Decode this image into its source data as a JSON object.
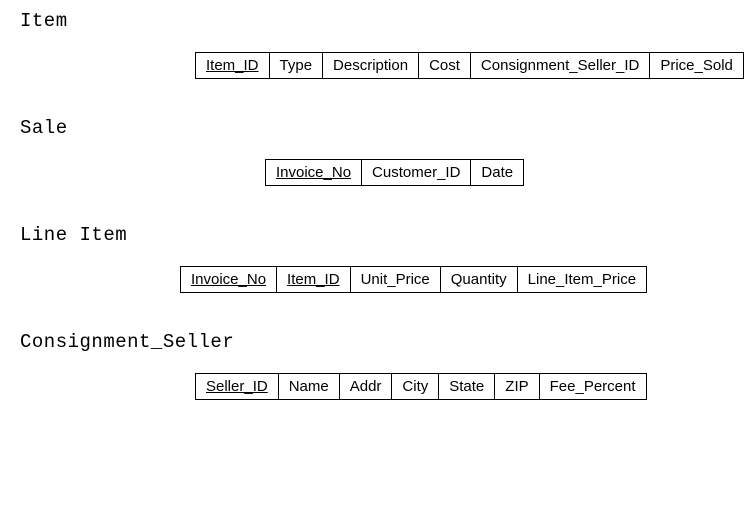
{
  "relations": [
    {
      "name": "Item",
      "indent": 175,
      "cols": [
        {
          "label": "Item_ID",
          "key": true
        },
        {
          "label": "Type",
          "key": false
        },
        {
          "label": "Description",
          "key": false
        },
        {
          "label": "Cost",
          "key": false
        },
        {
          "label": "Consignment_Seller_ID",
          "key": false
        },
        {
          "label": "Price_Sold",
          "key": false
        }
      ]
    },
    {
      "name": "Sale",
      "indent": 245,
      "cols": [
        {
          "label": "Invoice_No",
          "key": true
        },
        {
          "label": "Customer_ID",
          "key": false
        },
        {
          "label": "Date",
          "key": false
        }
      ]
    },
    {
      "name": "Line Item",
      "indent": 160,
      "cols": [
        {
          "label": "Invoice_No",
          "key": true
        },
        {
          "label": "Item_ID",
          "key": true
        },
        {
          "label": "Unit_Price",
          "key": false
        },
        {
          "label": "Quantity",
          "key": false
        },
        {
          "label": "Line_Item_Price",
          "key": false
        }
      ]
    },
    {
      "name": "Consignment_Seller",
      "indent": 175,
      "cols": [
        {
          "label": "Seller_ID",
          "key": true
        },
        {
          "label": "Name",
          "key": false
        },
        {
          "label": "Addr",
          "key": false
        },
        {
          "label": "City",
          "key": false
        },
        {
          "label": "State",
          "key": false
        },
        {
          "label": "ZIP",
          "key": false
        },
        {
          "label": "Fee_Percent",
          "key": false
        }
      ]
    }
  ]
}
